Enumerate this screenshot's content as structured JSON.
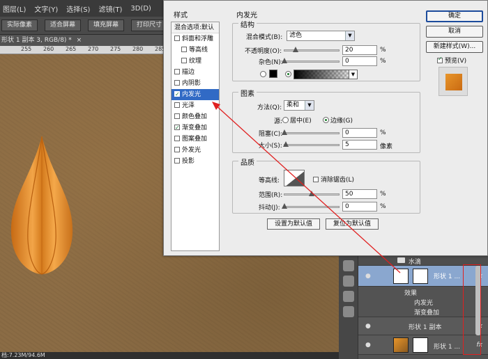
{
  "photoshop": {
    "menu": [
      "图层(L)",
      "文字(Y)",
      "选择(S)",
      "滤镜(T)",
      "3D(D)"
    ],
    "options": [
      "实际像素",
      "适合屏幕",
      "填充屏幕",
      "打印尺寸"
    ],
    "doc_tab": "形状 1 副本 3, RGB/8) *",
    "doc_tab_close": "×",
    "ruler_marks": [
      "255",
      "260",
      "265",
      "270",
      "275",
      "280",
      "285"
    ],
    "status": "档:7.23M/94.6M"
  },
  "dialog": {
    "nav_title": "样式",
    "nav_items": [
      {
        "label": "混合选项:默认",
        "checkbox": false,
        "checked": false,
        "active": false,
        "sub": false,
        "head": true
      },
      {
        "label": "斜面和浮雕",
        "checkbox": true,
        "checked": false,
        "active": false,
        "sub": false
      },
      {
        "label": "等高线",
        "checkbox": true,
        "checked": false,
        "active": false,
        "sub": true
      },
      {
        "label": "纹理",
        "checkbox": true,
        "checked": false,
        "active": false,
        "sub": true
      },
      {
        "label": "描边",
        "checkbox": true,
        "checked": false,
        "active": false,
        "sub": false
      },
      {
        "label": "内阴影",
        "checkbox": true,
        "checked": false,
        "active": false,
        "sub": false
      },
      {
        "label": "内发光",
        "checkbox": true,
        "checked": true,
        "active": true,
        "sub": false
      },
      {
        "label": "光泽",
        "checkbox": true,
        "checked": false,
        "active": false,
        "sub": false
      },
      {
        "label": "颜色叠加",
        "checkbox": true,
        "checked": false,
        "active": false,
        "sub": false
      },
      {
        "label": "渐变叠加",
        "checkbox": true,
        "checked": true,
        "active": false,
        "sub": false
      },
      {
        "label": "图案叠加",
        "checkbox": true,
        "checked": false,
        "active": false,
        "sub": false
      },
      {
        "label": "外发光",
        "checkbox": true,
        "checked": false,
        "active": false,
        "sub": false
      },
      {
        "label": "投影",
        "checkbox": true,
        "checked": false,
        "active": false,
        "sub": false
      }
    ],
    "section_title": "内发光",
    "structure": {
      "legend": "结构",
      "blend_label": "混合模式(B):",
      "blend_value": "滤色",
      "opacity_label": "不透明度(O):",
      "opacity_value": "20",
      "opacity_fraction": 0.2,
      "noise_label": "杂色(N):",
      "noise_value": "0",
      "noise_fraction": 0,
      "unit": "%"
    },
    "elements": {
      "legend": "图素",
      "method_label": "方法(Q):",
      "method_value": "柔和",
      "source_label": "源:",
      "source_center": "居中(E)",
      "source_edge": "边缘(G)",
      "choke_label": "阻塞(C):",
      "choke_value": "0",
      "choke_fraction": 0,
      "size_label": "大小(S):",
      "size_value": "5",
      "size_fraction": 0.02,
      "pct": "%",
      "px": "像素"
    },
    "quality": {
      "legend": "品质",
      "contour_label": "等高线:",
      "antialias_label": "消除锯齿(L)",
      "range_label": "范围(R):",
      "range_value": "50",
      "range_fraction": 0.5,
      "jitter_label": "抖动(J):",
      "jitter_value": "0",
      "jitter_fraction": 0,
      "unit": "%"
    },
    "set_default": "设置为默认值",
    "reset_default": "复位为默认值",
    "ok": "确定",
    "cancel": "取消",
    "new_style": "新建样式(W)...",
    "preview_label": "预览(V)"
  },
  "layers": {
    "group_name": "水滴",
    "selected_layer": "形状 1 ...",
    "effects_label": "效果",
    "effect_1": "内发光",
    "effect_2": "渐变叠加",
    "copy_layer": "形状 1 副本",
    "last_layer": "形状 1 ...",
    "fx": "fx",
    "eye": "●"
  },
  "colors": {
    "accent": "#316ac5",
    "drop_light": "#f0a040",
    "drop_dark": "#c86a10",
    "annotation_red": "#e02020"
  }
}
